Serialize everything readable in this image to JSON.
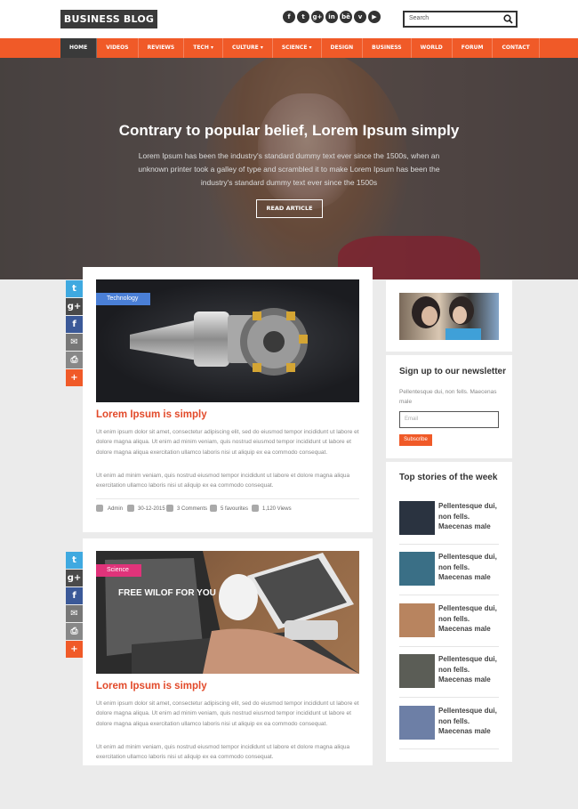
{
  "header": {
    "logo": "BUSINESS BLOG",
    "social": [
      "f",
      "t",
      "g+",
      "in",
      "bē",
      "v",
      "▶"
    ],
    "search_placeholder": "Search"
  },
  "nav": {
    "items": [
      "HOME",
      "VIDEOS",
      "REVIEWS",
      "TECH ▾",
      "CULTURE ▾",
      "SCIENCE ▾",
      "DESIGN",
      "BUSINESS",
      "WORLD",
      "FORUM",
      "CONTACT"
    ],
    "active": "HOME"
  },
  "hero": {
    "title": "Contrary to popular belief, Lorem Ipsum simply",
    "text": "Lorem Ipsum has been the industry's standard dummy text ever since the 1500s, when an unknown printer took a galley of type and scrambled it to make Lorem Ipsum has been the industry's standard dummy text ever since the 1500s",
    "button": "READ ARTICLE"
  },
  "share": [
    "t",
    "g+",
    "f",
    "✉",
    "⎙",
    "+"
  ],
  "posts": [
    {
      "tag": "Technology",
      "tag_color": "#4a7fd6",
      "title": "Lorem Ipsum is simply",
      "para1": "Ut enim ipsum dolor sit amet, consectetur adipiscing elit, sed do eiusmod tempor incididunt ut labore et dolore magna aliqua. Ut enim ad minim veniam, quis nostrud eiusmod tempor incididunt ut labore et dolore magna aliqua exercitation ullamco laboris nisi ut aliquip ex ea commodo consequat.",
      "para2": "Ut enim ad minim veniam, quis nostrud eiusmod tempor incididunt ut labore et dolore magna aliqua exercitation ullamco laboris nisi ut aliquip ex ea commodo consequat.",
      "meta": {
        "author": "Admin",
        "date": "30-12-2015",
        "comments": "3 Comments",
        "favourites": "5 favourites",
        "views": "1,120 Views"
      }
    },
    {
      "tag": "Science",
      "tag_color": "#e0337a",
      "title": "Lorem Ipsum is simply",
      "para1": "Ut enim ipsum dolor sit amet, consectetur adipiscing elit, sed do eiusmod tempor incididunt ut labore et dolore magna aliqua. Ut enim ad minim veniam, quis nostrud eiusmod tempor incididunt ut labore et dolore magna aliqua exercitation ullamco laboris nisi ut aliquip ex ea commodo consequat.",
      "para2": "Ut enim ad minim veniam, quis nostrud eiusmod tempor incididunt ut labore et dolore magna aliqua exercitation ullamco laboris nisi ut aliquip ex ea commodo consequat.",
      "screen_text": "FREE WILOF FOR YOU"
    }
  ],
  "sidebar": {
    "newsletter": {
      "title": "Sign up to our newsletter",
      "text": "Pellentesque dui, non fells. Maecenas male",
      "placeholder": "Email",
      "button": "Subscribe"
    },
    "top_stories": {
      "title": "Top stories of the week",
      "items": [
        {
          "title": "Pellentesque dui, non fells. Maecenas male",
          "color": "#2a3340"
        },
        {
          "title": "Pellentesque dui, non fells. Maecenas male",
          "color": "#3a6f86"
        },
        {
          "title": "Pellentesque dui, non fells. Maecenas male",
          "color": "#b8845f"
        },
        {
          "title": "Pellentesque dui, non fells. Maecenas male",
          "color": "#5b5d56"
        },
        {
          "title": "Pellentesque dui, non fells. Maecenas male",
          "color": "#6d7fa6"
        }
      ]
    }
  },
  "colors": {
    "accent": "#f05a28",
    "dark": "#3a3a3a"
  }
}
